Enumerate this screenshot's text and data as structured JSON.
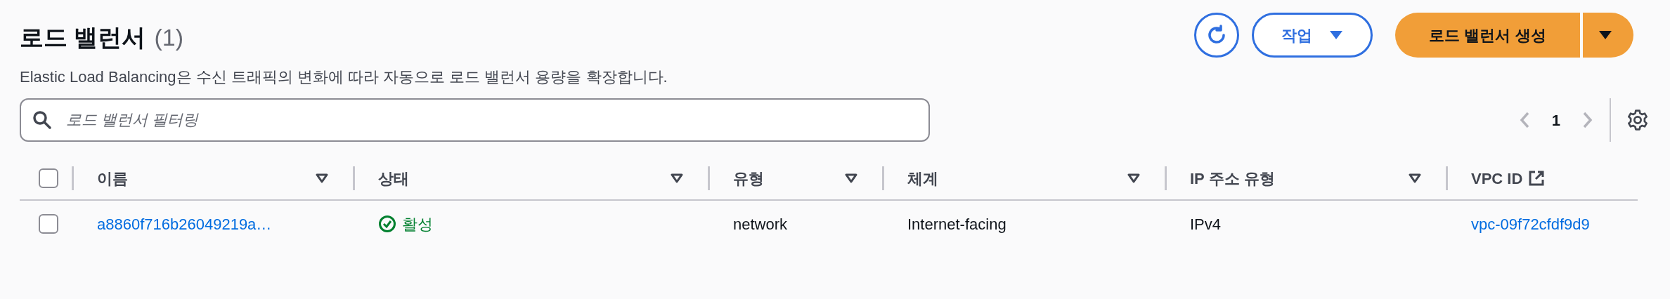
{
  "header": {
    "title": "로드 밸런서",
    "count": "(1)",
    "description": "Elastic Load Balancing은 수신 트래픽의 변화에 따라 자동으로 로드 밸런서 용량을 확장합니다."
  },
  "actions": {
    "actions_button": "작업",
    "create_button": "로드 밸런서 생성"
  },
  "search": {
    "placeholder": "로드 밸런서 필터링"
  },
  "pagination": {
    "current_page": "1"
  },
  "table": {
    "select_all_checked": false,
    "columns": [
      {
        "label": "이름",
        "kind": "sortable"
      },
      {
        "label": "상태",
        "kind": "sortable"
      },
      {
        "label": "유형",
        "kind": "sortable"
      },
      {
        "label": "체계",
        "kind": "sortable"
      },
      {
        "label": "IP 주소 유형",
        "kind": "sortable"
      },
      {
        "label": "VPC ID",
        "kind": "external"
      }
    ],
    "rows": [
      {
        "selected": false,
        "cells": [
          {
            "kind": "link",
            "text": "a8860f716b26049219a…"
          },
          {
            "kind": "status",
            "text": "활성"
          },
          {
            "kind": "text",
            "text": "network"
          },
          {
            "kind": "text",
            "text": "Internet-facing"
          },
          {
            "kind": "text",
            "text": "IPv4"
          },
          {
            "kind": "link",
            "text": "vpc-09f72cfdf9d9"
          }
        ]
      }
    ]
  }
}
